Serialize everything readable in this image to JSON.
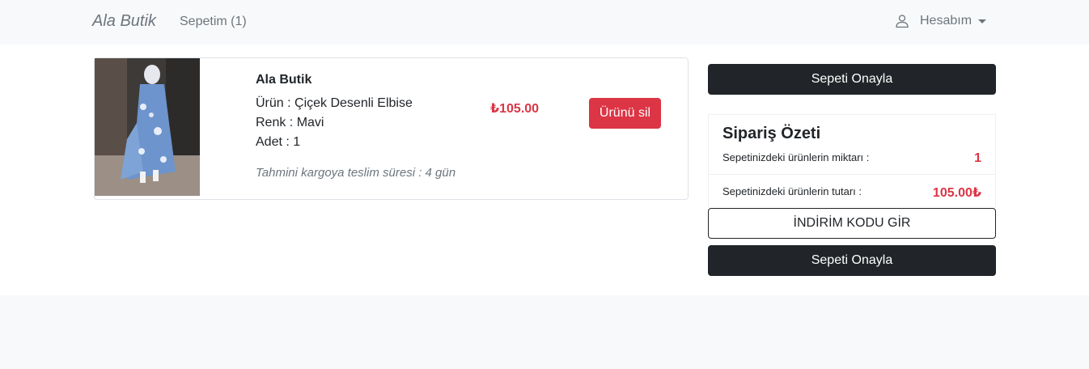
{
  "navbar": {
    "brand": "Ala Butik",
    "cart_link": "Sepetim (1)",
    "account_label": "Hesabım",
    "account_icon": "user-icon",
    "caret_icon": "chevron-down-icon"
  },
  "cart_item": {
    "store": "Ala Butik",
    "product_line": "Ürün : Çiçek Desenli Elbise",
    "color_line": "Renk : Mavi",
    "quantity_line": "Adet : 1",
    "shipping_note": "Tahmini kargoya teslim süresi : 4 gün",
    "price": "₺105.00",
    "remove_label": "Ürünü sil"
  },
  "summary": {
    "confirm_top_label": "Sepeti Onayla",
    "title": "Sipariş Özeti",
    "count_label": "Sepetinizdeki ürünlerin miktarı :",
    "count_value": "1",
    "total_label": "Sepetinizdeki ürünlerin tutarı :",
    "total_value": "105.00₺",
    "discount_label": "İNDİRİM KODU GİR",
    "confirm_bottom_label": "Sepeti Onayla"
  },
  "colors": {
    "accent_red": "#dc3545",
    "dark_button": "#212529",
    "navbar_bg": "#f8f9fa"
  }
}
